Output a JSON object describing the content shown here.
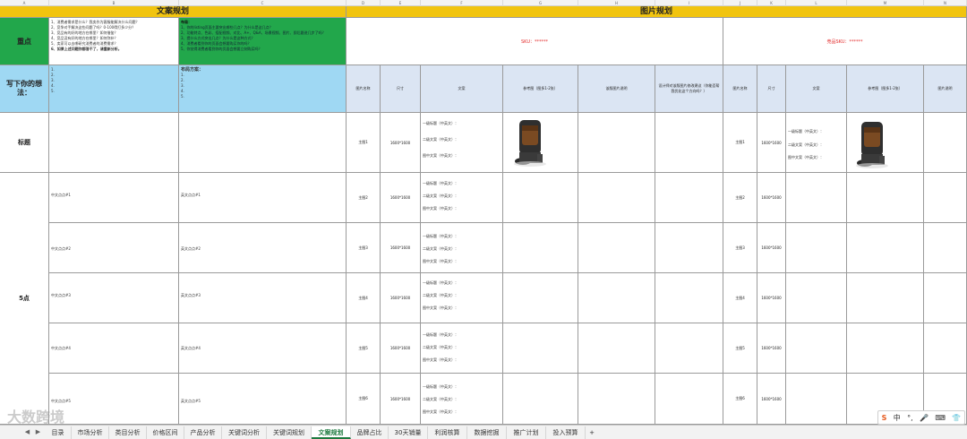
{
  "column_headers": [
    "A",
    "B",
    "C",
    "D",
    "E",
    "F",
    "G",
    "H",
    "I",
    "J",
    "K",
    "L",
    "M",
    "N"
  ],
  "banner_left": "文案规划",
  "banner_right": "图片规划",
  "row1_label": "重点",
  "focus_questions": [
    "1、消费者需求是什么？我卖作为客服能解决什么问题？",
    "2、竞争对手解决这些问题了吗？0-100得打多少分？",
    "3、竞品有的好的地方在哪里？如何借鉴？",
    "4、竞品没有好的地方在哪里？如何弥补？",
    "5、卖家可以去哪研究消费者的消费需求？",
    "6、如果上述问题你都答不了，请重新分析。"
  ],
  "layout_title": "布局：",
  "layout_points": [
    "1、你的listing页面主要突出哪些几点？为什么是这几点？",
    "2、功能特点、色彩、搭配视频、对比、A+、Q&A、场景视频、图片、即后跟进几步了吗？",
    "3、提什么方式突出几点？为什么是这种方式？",
    "4、消费者看到你的页面会想要购买你的吗？",
    "5、你觉得消费者看到你的页面会想要立刻购买吗？"
  ],
  "sku_label": "SKU：******",
  "compare_sku_label": "竞品SKU：******",
  "write_label": "写下你的想法：",
  "write_items": [
    "1.",
    "2.",
    "3.",
    "4.",
    "5."
  ],
  "plan_title": "布局方案：",
  "plan_items": [
    "1.",
    "2.",
    "3.",
    "4.",
    "5."
  ],
  "table_headers_left": [
    "图片名称",
    "尺寸",
    "文案",
    "参考图（图多1-2张）",
    "该版图片说明",
    "设计师对该版图片修改建议（你能否帮我优化这个方向吗？）"
  ],
  "table_headers_right": [
    "图片名称",
    "尺寸",
    "文案",
    "参考图（图多1-2张）",
    "图片说明"
  ],
  "title_row_label": "标题",
  "five_points_label": "5点",
  "size_value": "1600*1600",
  "copy_lines": [
    "一级标题（中英文）：",
    "二级文案（中英文）：",
    "图中文案（中英文）："
  ],
  "rows": [
    {
      "img_name": "主图1",
      "cn": "",
      "en": ""
    },
    {
      "img_name": "主图2",
      "cn": "中文点点#1",
      "en": "英文点点#1"
    },
    {
      "img_name": "主图3",
      "cn": "中文点点#2",
      "en": "英文点点#2"
    },
    {
      "img_name": "主图4",
      "cn": "中文点点#3",
      "en": "英文点点#3"
    },
    {
      "img_name": "主图5",
      "cn": "中文点点#4",
      "en": "英文点点#4"
    },
    {
      "img_name": "主图6",
      "cn": "中文点点#5",
      "en": "英文点点#5"
    }
  ],
  "watermark": "大数跨境",
  "tabs": [
    "目录",
    "市场分析",
    "类目分析",
    "价格区间",
    "产品分析",
    "关键词分析",
    "关键词规划",
    "文案规划",
    "品牌占比",
    "30天销量",
    "利润核算",
    "数据挖掘",
    "推广计划",
    "投入预算"
  ],
  "active_tab": "文案规划",
  "add_tab_symbol": "+",
  "ime_items": [
    "S",
    "中",
    "°,",
    "🎤",
    "⌨",
    "👕"
  ],
  "colors": {
    "banner": "#f1c40f",
    "green": "#22a74b",
    "light_blue": "#9fd8f3",
    "header_blue": "#dbe5f3",
    "red": "#e32b2b",
    "active_tab": "#1d7a3f"
  }
}
